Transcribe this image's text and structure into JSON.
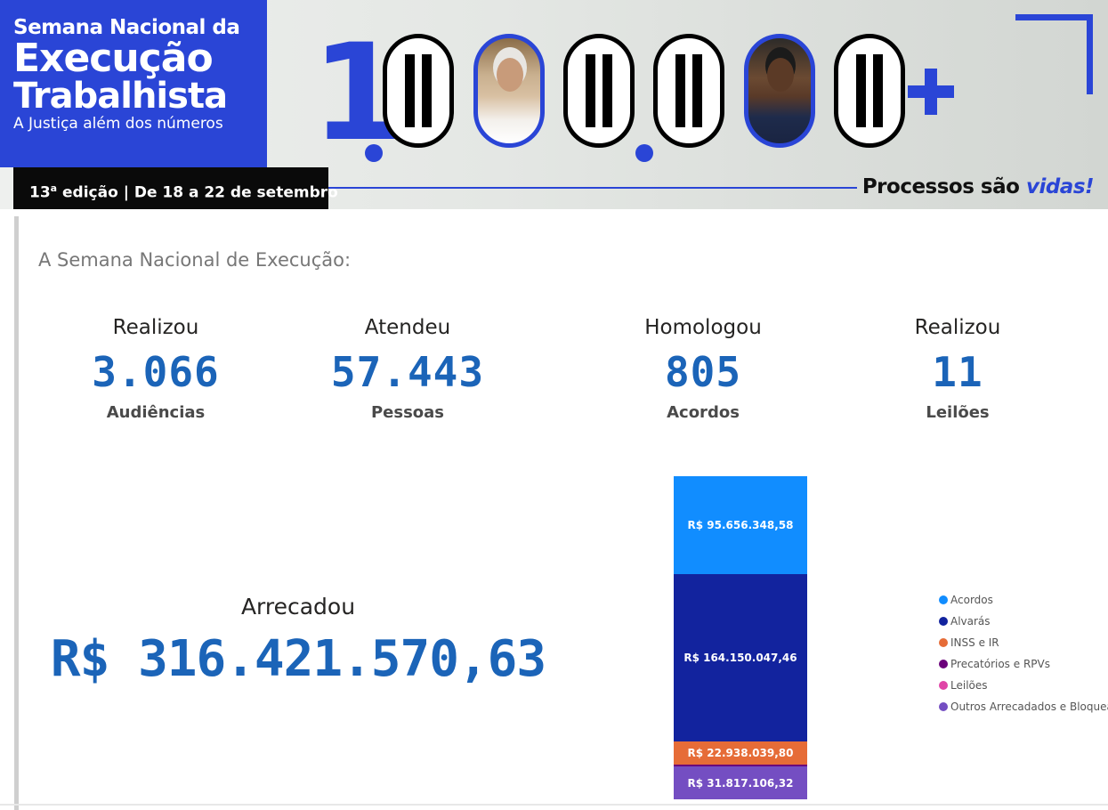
{
  "banner": {
    "title_line1": "Semana Nacional da",
    "title_line2": "Execução",
    "title_line3": "Trabalhista",
    "title_line4": "A Justiça além dos números",
    "edition_ordinal": "13",
    "edition_ordinal_suffix": "a",
    "edition_rest": " edição | De 18 a 22 de setembro",
    "big_number_one": "1",
    "tagline_prefix": "Processos são ",
    "tagline_accent": "vidas!",
    "brand_color": "#2a45d6"
  },
  "report": {
    "section_title": "A Semana Nacional de Execução:",
    "kpis": [
      {
        "verb": "Realizou",
        "value": "3.066",
        "noun": "Audiências"
      },
      {
        "verb": "Atendeu",
        "value": "57.443",
        "noun": "Pessoas"
      },
      {
        "verb": "Homologou",
        "value": "805",
        "noun": "Acordos"
      },
      {
        "verb": "Realizou",
        "value": "11",
        "noun": "Leilões"
      }
    ],
    "total": {
      "verb": "Arrecadou",
      "value": "R$ 316.421.570,63"
    },
    "accent_color": "#1b64b8"
  },
  "chart_data": {
    "type": "bar",
    "stacked": true,
    "series": [
      {
        "name": "Acordos",
        "value": 95656348.58,
        "label": "R$ 95.656.348,58",
        "color": "#118dff"
      },
      {
        "name": "Alvarás",
        "value": 164150047.46,
        "label": "R$ 164.150.047,46",
        "color": "#12239e"
      },
      {
        "name": "INSS e IR",
        "value": 22938039.8,
        "label": "R$ 22.938.039,80",
        "color": "#e66c37"
      },
      {
        "name": "Precatórios e RPVs",
        "value": 1500000,
        "label": "",
        "color": "#6b007b"
      },
      {
        "name": "Leilões",
        "value": 360000,
        "label": "",
        "color": "#e044a7"
      },
      {
        "name": "Outros Arrecadados e Bloquea...",
        "value": 31817106.32,
        "label": "R$ 31.817.106,32",
        "color": "#744ec2"
      }
    ],
    "total": 316421570.63,
    "legend_position": "right"
  }
}
